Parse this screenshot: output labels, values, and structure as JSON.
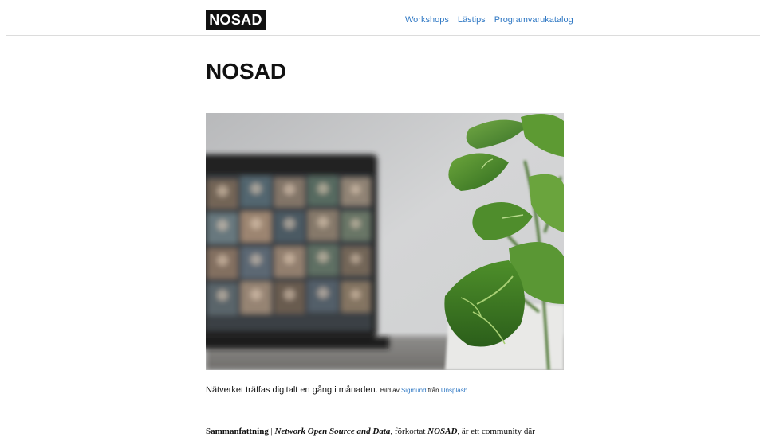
{
  "header": {
    "logo": "NOSAD",
    "nav": [
      {
        "label": "Workshops"
      },
      {
        "label": "Lästips"
      },
      {
        "label": "Programvarukatalog"
      }
    ]
  },
  "page": {
    "title": "NOSAD"
  },
  "caption": {
    "text": "Nätverket träffas digitalt en gång i månaden.",
    "credit_prefix": "Bild av",
    "author": "Sigmund",
    "credit_middle": "från",
    "source": "Unsplash",
    "credit_suffix": "."
  },
  "summary": {
    "label": "Sammanfattning",
    "separator": "|",
    "name": "Network Open Source and Data",
    "text_1": ", förkortat ",
    "abbr": "NOSAD",
    "text_2": ", är ett community där"
  },
  "colors": {
    "link": "#2f78c4",
    "logo_bg": "#111111",
    "logo_text": "#ffffff",
    "divider": "#dcdcdc"
  }
}
